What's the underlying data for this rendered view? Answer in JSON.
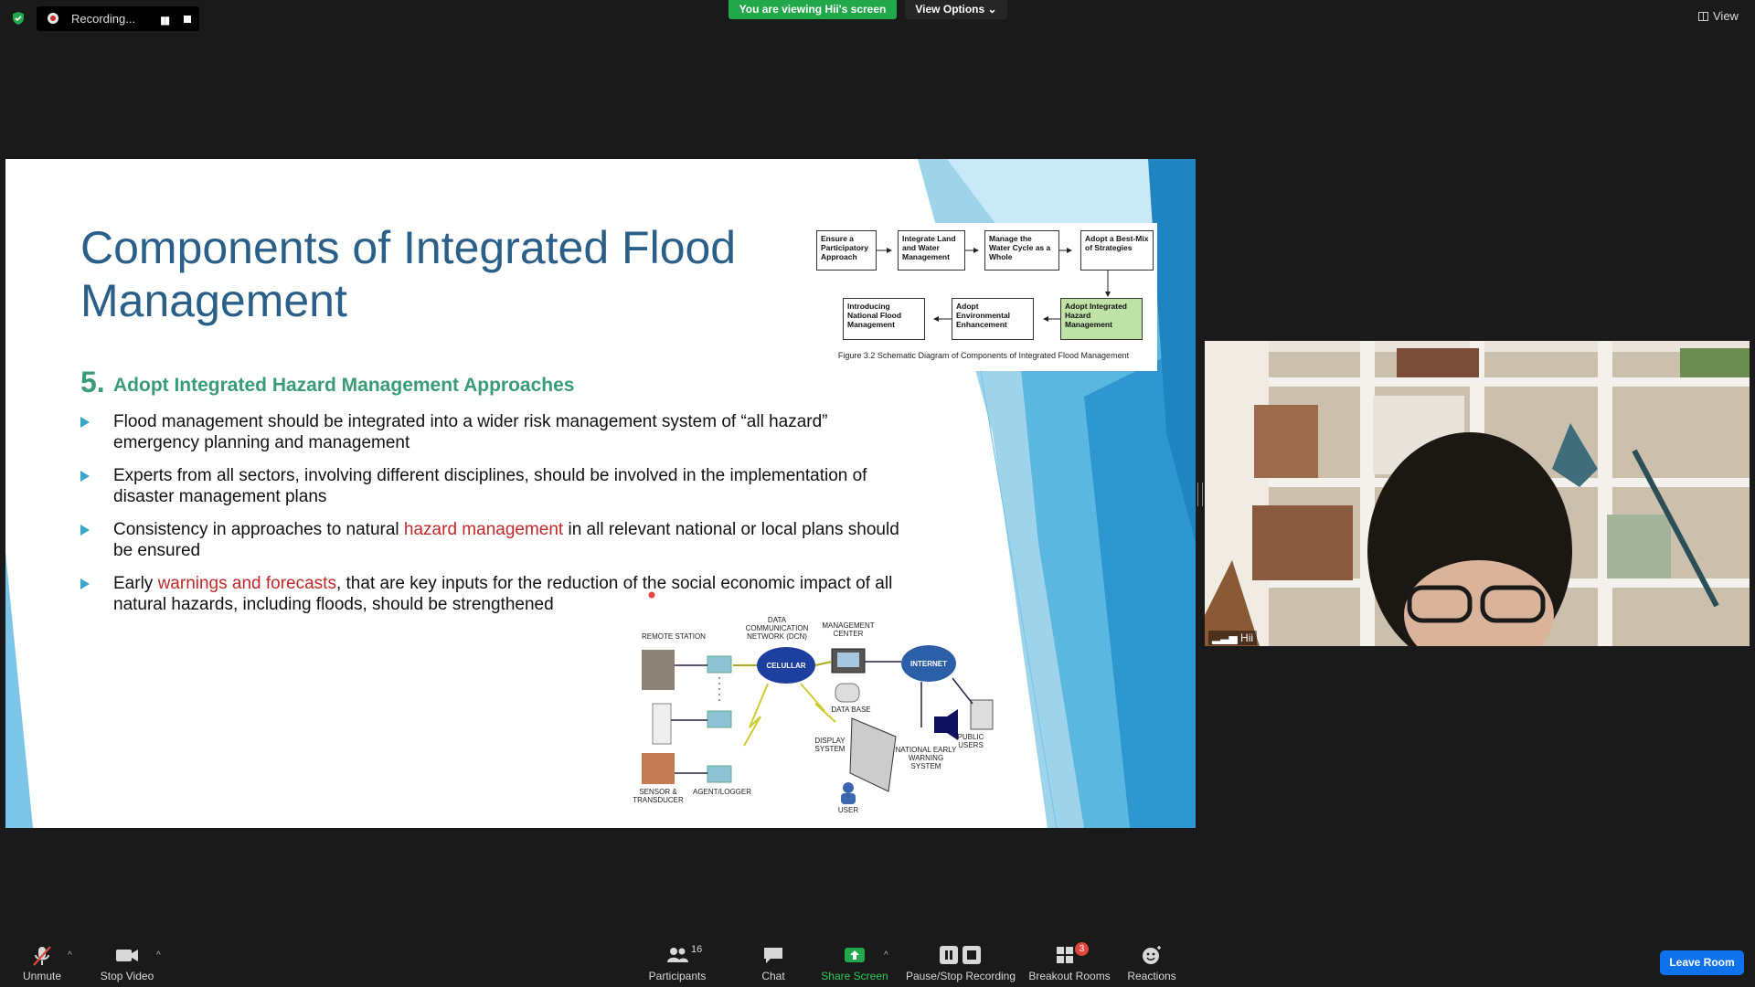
{
  "topbar": {
    "recording_label": "Recording...",
    "banner": "You are viewing Hii's screen",
    "view_options": "View Options",
    "view_label": "View"
  },
  "slide": {
    "title": "Components of Integrated Flood Management",
    "section_number": "5.",
    "section_title": "Adopt Integrated Hazard Management Approaches",
    "bullets": [
      {
        "pre": "Flood management should be integrated into a wider risk management system of “all hazard” emergency planning and management",
        "red": "",
        "post": ""
      },
      {
        "pre": "Experts from all sectors, involving different disciplines, should be involved in the implementation of disaster management plans",
        "red": "",
        "post": ""
      },
      {
        "pre": "Consistency in approaches to natural ",
        "red": "hazard management",
        "post": " in all relevant national or local plans should be ensured"
      },
      {
        "pre": "Early ",
        "red": "warnings and forecasts",
        "post": ", that are key inputs for the reduction of the social economic impact of all natural hazards, including floods, should be strengthened"
      }
    ],
    "figure": {
      "boxes": [
        "Ensure a Participatory Approach",
        "Integrate Land and Water Management",
        "Manage the Water Cycle as a Whole",
        "Adopt a Best-Mix of Strategies",
        "Adopt Integrated Hazard Management",
        "Adopt Environmental Enhancement",
        "Introducing National Flood Management"
      ],
      "caption": "Figure 3.2 Schematic Diagram of Components of Integrated Flood Management"
    },
    "network": {
      "remote_station": "REMOTE STATION",
      "dcn": "DATA COMMUNICATION NETWORK (DCN)",
      "management_center": "MANAGEMENT CENTER",
      "cellular": "CELULLAR",
      "internet": "INTERNET",
      "data_base": "DATA BASE",
      "display_system": "DISPLAY SYSTEM",
      "national_warning": "NATIONAL EARLY WARNING SYSTEM",
      "public_users": "PUBLIC USERS",
      "sensor": "SENSOR & TRANSDUCER",
      "agent": "AGENT/LOGGER",
      "user": "USER"
    }
  },
  "video": {
    "name": "Hii"
  },
  "toolbar": {
    "unmute": "Unmute",
    "stop_video": "Stop Video",
    "participants_count": "16",
    "participants": "Participants",
    "chat": "Chat",
    "share_screen": "Share Screen",
    "pause_stop_recording": "Pause/Stop Recording",
    "breakout_rooms": "Breakout Rooms",
    "breakout_badge": "3",
    "reactions": "Reactions",
    "leave_room": "Leave Room"
  },
  "colors": {
    "share_green": "#23a74b",
    "leave_blue": "#0e72ed",
    "title_blue": "#2a5f8a",
    "section_green": "#3a9c77",
    "highlight_red": "#c0282a"
  }
}
